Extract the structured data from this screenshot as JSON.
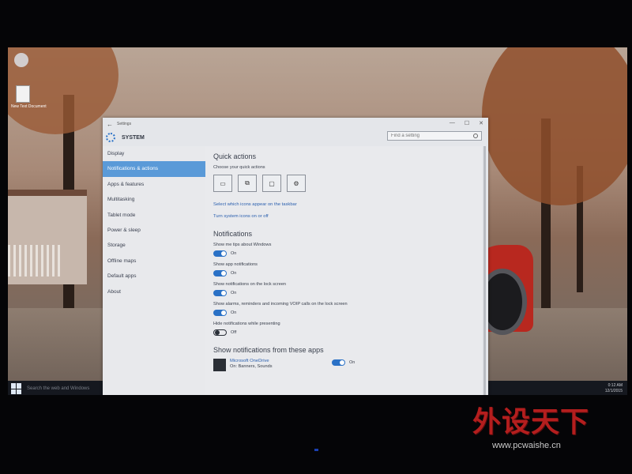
{
  "desktop": {
    "file_label": "New Text Document"
  },
  "taskbar": {
    "search_placeholder": "Search the web and Windows",
    "tray_time": "0:12 AM",
    "tray_date": "12/1/2015"
  },
  "window": {
    "title": "Settings",
    "section": "SYSTEM",
    "search_placeholder": "Find a setting",
    "controls": [
      "—",
      "☐",
      "✕"
    ]
  },
  "sidebar": {
    "items": [
      {
        "label": "Display",
        "active": false
      },
      {
        "label": "Notifications & actions",
        "active": true
      },
      {
        "label": "Apps & features",
        "active": false
      },
      {
        "label": "Multitasking",
        "active": false
      },
      {
        "label": "Tablet mode",
        "active": false
      },
      {
        "label": "Power & sleep",
        "active": false
      },
      {
        "label": "Storage",
        "active": false
      },
      {
        "label": "Offline maps",
        "active": false
      },
      {
        "label": "Default apps",
        "active": false
      },
      {
        "label": "About",
        "active": false
      }
    ]
  },
  "content": {
    "quick_actions": {
      "title": "Quick actions",
      "subtitle": "Choose your quick actions",
      "tiles": [
        "tablet-mode-icon",
        "connect-icon",
        "note-icon",
        "settings-icon"
      ]
    },
    "links": {
      "taskbar_icons": "Select which icons appear on the taskbar",
      "system_icons": "Turn system icons on or off"
    },
    "notifications": {
      "title": "Notifications",
      "settings": [
        {
          "label": "Show me tips about Windows",
          "state": "On"
        },
        {
          "label": "Show app notifications",
          "state": "On"
        },
        {
          "label": "Show notifications on the lock screen",
          "state": "On"
        },
        {
          "label": "Show alarms, reminders and incoming VOIP calls on the lock screen",
          "state": "On"
        },
        {
          "label": "Hide notifications while presenting",
          "state": "Off"
        }
      ]
    },
    "apps": {
      "title": "Show notifications from these apps",
      "items": [
        {
          "name": "Microsoft OneDrive",
          "desc": "On: Banners, Sounds",
          "state": "On"
        }
      ]
    }
  },
  "watermark": {
    "brand": "外设天下",
    "url": "www.pcwaishe.cn"
  },
  "colors": {
    "accent": "#2a71c6",
    "nav_active": "#5a9ad8",
    "watermark_red": "#b41e1e"
  }
}
